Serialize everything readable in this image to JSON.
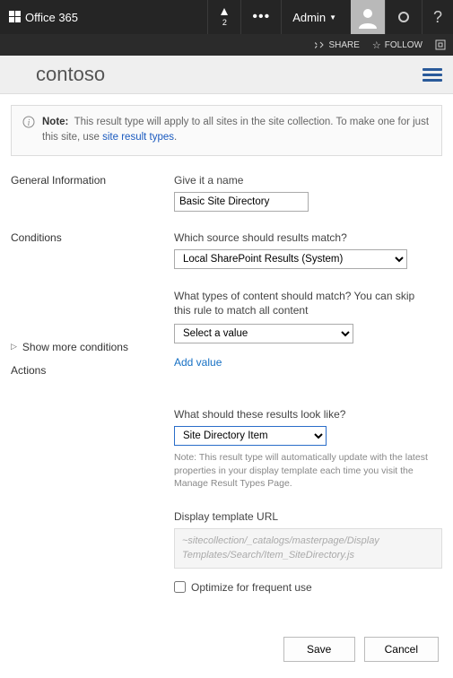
{
  "topbar": {
    "brand": "Office 365",
    "notif_count": "2",
    "admin_label": "Admin"
  },
  "subbar": {
    "share": "SHARE",
    "follow": "FOLLOW"
  },
  "logo_text": "contoso",
  "note": {
    "label": "Note:",
    "text_a": "This result type will apply to all sites in the site collection. To make one for just this site, use ",
    "link": "site result types",
    "text_b": "."
  },
  "sections": {
    "general": "General Information",
    "conditions": "Conditions",
    "show_more": "Show more conditions",
    "actions": "Actions"
  },
  "fields": {
    "name_label": "Give it a name",
    "name_value": "Basic Site Directory",
    "source_label": "Which source should results match?",
    "source_value": "Local SharePoint Results (System)",
    "content_label": "What types of content should match? You can skip this rule to match all content",
    "content_value": "Select a value",
    "add_value": "Add value",
    "look_label": "What should these results look like?",
    "look_value": "Site Directory Item",
    "look_note": "Note: This result type will automatically update with the latest properties in your display template each time you visit the Manage Result Types Page.",
    "url_label": "Display template URL",
    "url_value": "~sitecollection/_catalogs/masterpage/Display Templates/Search/Item_SiteDirectory.js",
    "optimize": "Optimize for frequent use"
  },
  "buttons": {
    "save": "Save",
    "cancel": "Cancel"
  }
}
